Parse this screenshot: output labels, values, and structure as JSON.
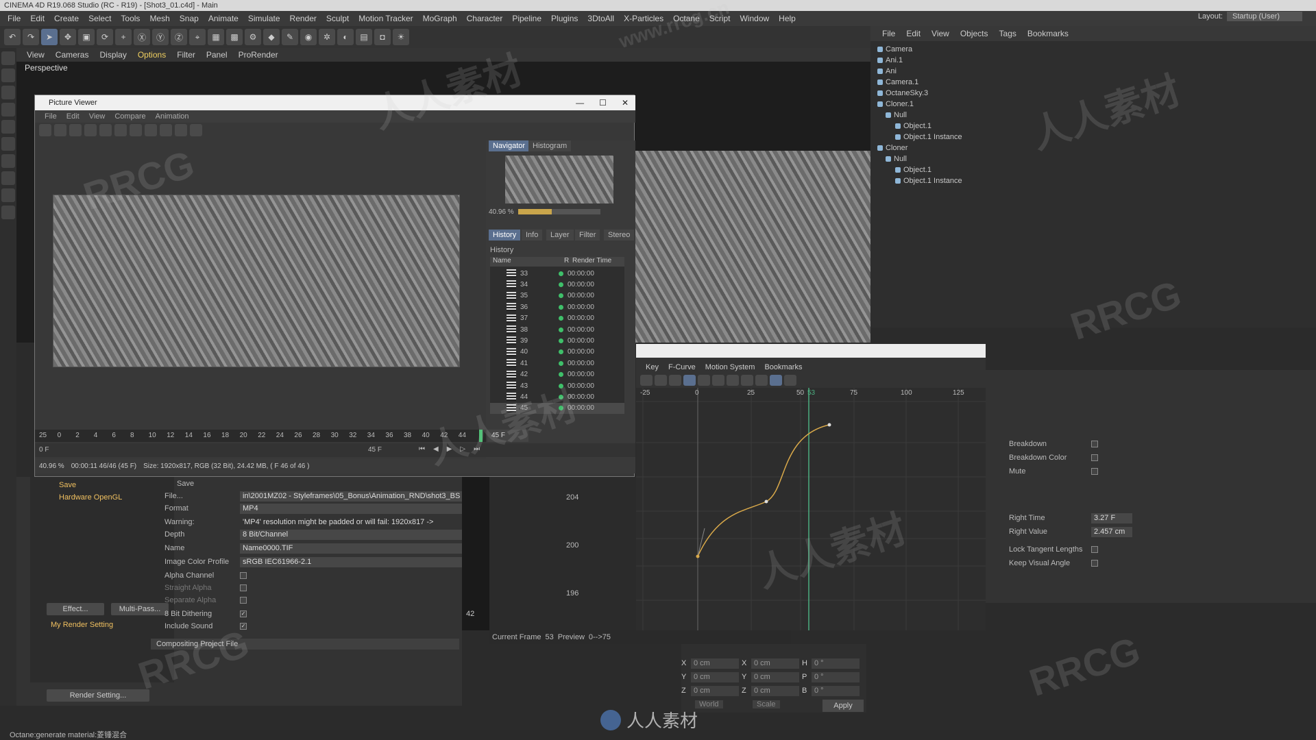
{
  "app": {
    "title": "CINEMA 4D R19.068 Studio (RC - R19) - [Shot3_01.c4d] - Main"
  },
  "menubar": [
    "File",
    "Edit",
    "Create",
    "Select",
    "Tools",
    "Mesh",
    "Snap",
    "Animate",
    "Simulate",
    "Render",
    "Sculpt",
    "Motion Tracker",
    "MoGraph",
    "Character",
    "Pipeline",
    "Plugins",
    "3DtoAll",
    "X-Particles",
    "Octane",
    "Script",
    "Window",
    "Help"
  ],
  "layout": {
    "label": "Layout:",
    "value": "Startup (User)"
  },
  "viewport": {
    "menu": [
      "View",
      "Cameras",
      "Display",
      "Options",
      "Filter",
      "Panel",
      "ProRender"
    ],
    "active": "Options",
    "label": "Perspective"
  },
  "object_manager": {
    "menu": [
      "File",
      "Edit",
      "View",
      "Objects",
      "Tags",
      "Bookmarks"
    ],
    "objects": [
      "Camera",
      "Ani.1",
      "Ani",
      "Camera.1",
      "OctaneSky.3",
      "Cloner.1",
      "Null",
      "Object.1",
      "Object.1 Instance",
      "Cloner",
      "Null",
      "Object.1",
      "Object.1 Instance"
    ]
  },
  "picture_viewer": {
    "title": "Picture Viewer",
    "menu": [
      "File",
      "Edit",
      "View",
      "Compare",
      "Animation"
    ],
    "nav_tabs": [
      "Navigator",
      "Histogram"
    ],
    "zoom": "40.96 %",
    "zoom_fraction": 0.4096,
    "info_tabs": [
      "History",
      "Info",
      "Layer",
      "Filter",
      "Stereo"
    ],
    "history_label": "History",
    "history_cols": [
      "Name",
      "R",
      "Render Time"
    ],
    "history_rows": [
      {
        "name": "33",
        "time": "00:00:00"
      },
      {
        "name": "34",
        "time": "00:00:00"
      },
      {
        "name": "35",
        "time": "00:00:00"
      },
      {
        "name": "36",
        "time": "00:00:00"
      },
      {
        "name": "37",
        "time": "00:00:00"
      },
      {
        "name": "38",
        "time": "00:00:00"
      },
      {
        "name": "39",
        "time": "00:00:00"
      },
      {
        "name": "40",
        "time": "00:00:00"
      },
      {
        "name": "41",
        "time": "00:00:00"
      },
      {
        "name": "42",
        "time": "00:00:00"
      },
      {
        "name": "43",
        "time": "00:00:00"
      },
      {
        "name": "44",
        "time": "00:00:00"
      },
      {
        "name": "45",
        "time": "00:00:00"
      }
    ],
    "timeline_ticks": [
      "25",
      "0",
      "2",
      "4",
      "6",
      "8",
      "10",
      "12",
      "14",
      "16",
      "18",
      "20",
      "22",
      "24",
      "26",
      "28",
      "30",
      "32",
      "34",
      "36",
      "38",
      "40",
      "42",
      "44"
    ],
    "frame_box": "45 F",
    "start_frame": "0 F",
    "end_frame": "45 F",
    "status_zoom": "40.96 %",
    "status_time": "00:00:11 46/46 (45 F)",
    "status_size": "Size: 1920x817, RGB (32 Bit), 24.42 MB, ( F 46 of 46 )"
  },
  "render_settings": {
    "left": {
      "save": "Save",
      "hardware": "Hardware OpenGL",
      "effect_btn": "Effect...",
      "multipass_btn": "Multi-Pass...",
      "my_setting": "My Render Setting",
      "render_btn": "Render Setting..."
    },
    "save_label": "Save",
    "rows": [
      {
        "label": "File...",
        "value": "in\\2001MZ02 - Styleframes\\05_Bonus\\Animation_RND\\shot3_BS"
      },
      {
        "label": "Format",
        "value": "MP4"
      },
      {
        "label": "Warning:",
        "value": "'MP4' resolution might be padded or will fail: 1920x817 ->"
      },
      {
        "label": "Depth",
        "value": "8 Bit/Channel"
      },
      {
        "label": "Name",
        "value": "Name0000.TIF"
      },
      {
        "label": "Image Color Profile",
        "value": "sRGB IEC61966-2.1"
      }
    ],
    "checks": [
      {
        "label": "Alpha Channel",
        "on": false
      },
      {
        "label": "Straight Alpha",
        "on": false
      },
      {
        "label": "Separate Alpha",
        "on": false
      },
      {
        "label": "8 Bit Dithering",
        "on": true
      },
      {
        "label": "Include Sound",
        "on": true
      }
    ],
    "compositing": "Compositing Project File",
    "mid_value": "42"
  },
  "timeline_window": {
    "menu": [
      "Key",
      "F-Curve",
      "Motion System",
      "Bookmarks"
    ],
    "x_ticks": [
      "-25",
      "0",
      "25",
      "50",
      "53",
      "75",
      "100",
      "125"
    ],
    "y_ticks": [
      "204",
      "200",
      "196"
    ],
    "current_frame_label": "Current Frame",
    "current_frame": "53",
    "preview_label": "Preview",
    "preview_range": "0-->75"
  },
  "attributes": {
    "checks": [
      "Breakdown",
      "Breakdown Color",
      "Mute"
    ],
    "right_time_label": "Right Time",
    "right_time": "3.27 F",
    "right_value_label": "Right Value",
    "right_value": "2.457 cm",
    "lock_label": "Lock Tangent Lengths",
    "keep_label": "Keep Visual Angle"
  },
  "coords": {
    "rows": [
      [
        "X",
        "0 cm",
        "X",
        "0 cm",
        "H",
        "0 °"
      ],
      [
        "Y",
        "0 cm",
        "Y",
        "0 cm",
        "P",
        "0 °"
      ],
      [
        "Z",
        "0 cm",
        "Z",
        "0 cm",
        "B",
        "0 °"
      ]
    ],
    "mode1": "World",
    "mode2": "Scale",
    "apply": "Apply"
  },
  "statusbar": "Octane:generate material:菱锤混合",
  "brand": "人人素材",
  "watermarks": [
    "RRCG",
    "人人素材",
    "www.rrcg.cn"
  ]
}
